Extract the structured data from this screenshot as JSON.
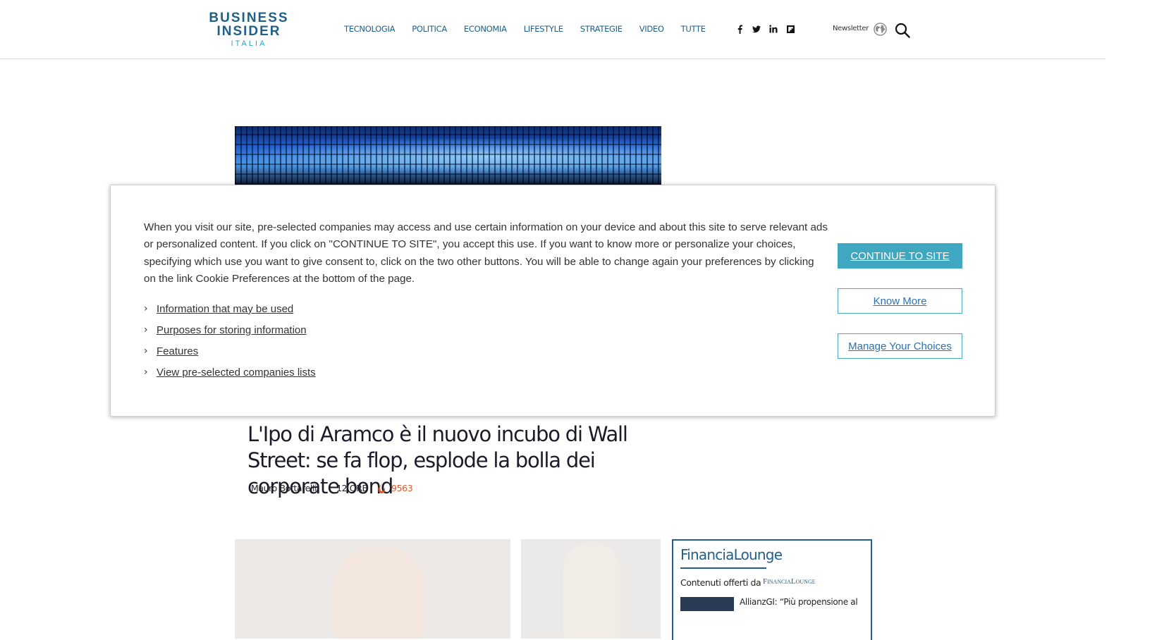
{
  "header": {
    "logo": {
      "line1": "BUSINESS",
      "line2": "INSIDER",
      "line3": "ITALIA"
    },
    "nav": [
      "TECNOLOGIA",
      "POLITICA",
      "ECONOMIA",
      "LIFESTYLE",
      "STRATEGIE",
      "VIDEO",
      "TUTTE"
    ],
    "social_icons": [
      "facebook-icon",
      "twitter-icon",
      "linkedin-icon",
      "flipboard-icon"
    ],
    "newsletter": "Newsletter",
    "brand_color": "#1f5f8b"
  },
  "article": {
    "title": "L'Ipo di Aramco è il nuovo incubo di Wall Street: se fa flop, esplode la bolla dei corporate bond",
    "author": "Mauro Bottarelli",
    "time": "12 ORE",
    "views": "9563",
    "views_color": "#e0572a"
  },
  "sidebar_box": {
    "title": "FinanciaLounge",
    "offered_by": "Contenuti offerti da",
    "brand": "FinanciaLounge",
    "snippet": "AllianzGI: “Più propensione al"
  },
  "consent": {
    "text": "When you visit our site, pre-selected companies may access and use certain information on your device and about this site to serve relevant ads or personalized content. If you click on \"CONTINUE TO SITE\", you accept this use. If you want to know more or personalize your choices, specifying which use you want to give consent to, click on the two other buttons. You will be able to change again your preferences by clicking on the link Cookie Preferences at the bottom of the page.",
    "links": [
      "Information that may be used",
      "Purposes for storing information",
      "Features",
      "View pre-selected companies lists"
    ],
    "continue_label": "CONTINUE TO SITE",
    "know_more_label": "Know More",
    "manage_label": "Manage Your Choices",
    "accent_color": "#3fa7c0"
  }
}
